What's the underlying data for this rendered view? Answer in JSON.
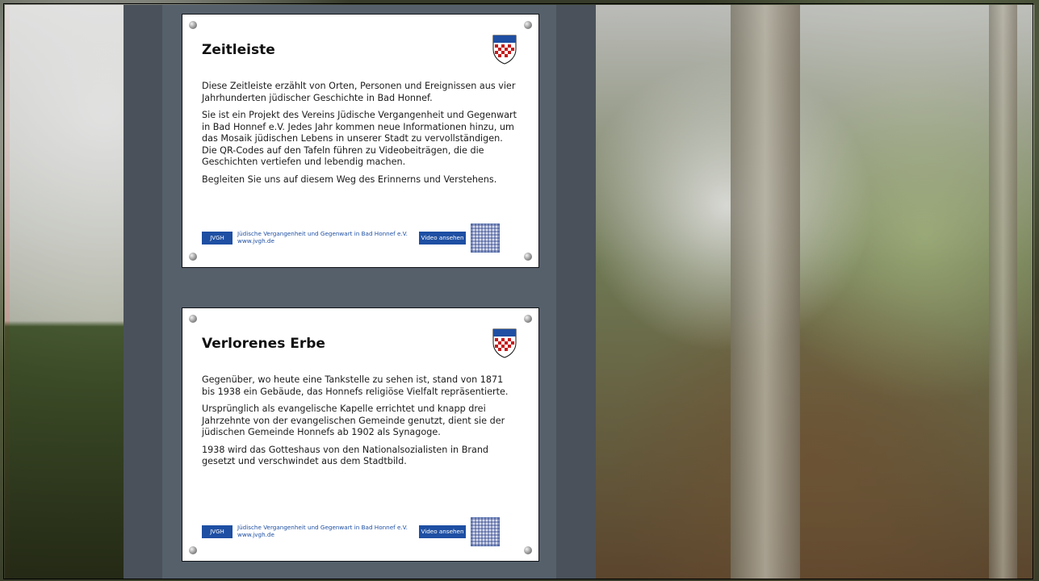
{
  "scene": {
    "cards": [
      {
        "title": "Zeitleiste",
        "paragraphs": [
          "Diese Zeitleiste erzählt von Orten, Personen und Ereignissen aus vier Jahrhunderten jüdischer Geschichte in Bad Honnef.",
          "Sie ist ein Projekt des Vereins Jüdische Vergangenheit und Gegenwart in Bad Honnef e.V. Jedes Jahr kommen neue Informationen hinzu, um das Mosaik jüdischen Lebens in unserer Stadt zu vervollständigen. Die QR-Codes auf den Tafeln führen zu Videobeiträgen, die die Geschichten vertiefen und lebendig machen.",
          "Begleiten Sie uns auf diesem Weg des Erinnerns und Verstehens."
        ],
        "footer": {
          "org_badge": "JVGH",
          "org_line_1": "Jüdische Vergangenheit und Gegenwart in Bad Honnef e.V.",
          "org_line_2": "www.jvgh.de",
          "video_label": "Video ansehen"
        }
      },
      {
        "title": "Verlorenes Erbe",
        "paragraphs": [
          "Gegenüber, wo heute eine Tankstelle zu sehen ist, stand von 1871 bis 1938 ein Gebäude, das Honnefs religiöse Vielfalt repräsentierte.",
          "Ursprünglich als evangelische Kapelle errichtet und knapp drei Jahrzehnte von der evangelischen Gemeinde genutzt, dient sie der jüdischen Gemeinde Honnefs ab 1902 als Synagoge.",
          "1938 wird das Gotteshaus von den Nationalsozialisten in Brand gesetzt und verschwindet aus dem Stadtbild."
        ],
        "footer": {
          "org_badge": "JVGH",
          "org_line_1": "Jüdische Vergangenheit und Gegenwart in Bad Honnef e.V.",
          "org_line_2": "www.jvgh.de",
          "video_label": "Video ansehen"
        }
      }
    ],
    "colors": {
      "board": "#4a515a",
      "card_bg": "#ffffff",
      "accent_blue": "#1e4fa3"
    },
    "icons": {
      "crest": "coat-of-arms-icon",
      "qr": "qr-code-icon",
      "screw": "screw-icon"
    }
  }
}
